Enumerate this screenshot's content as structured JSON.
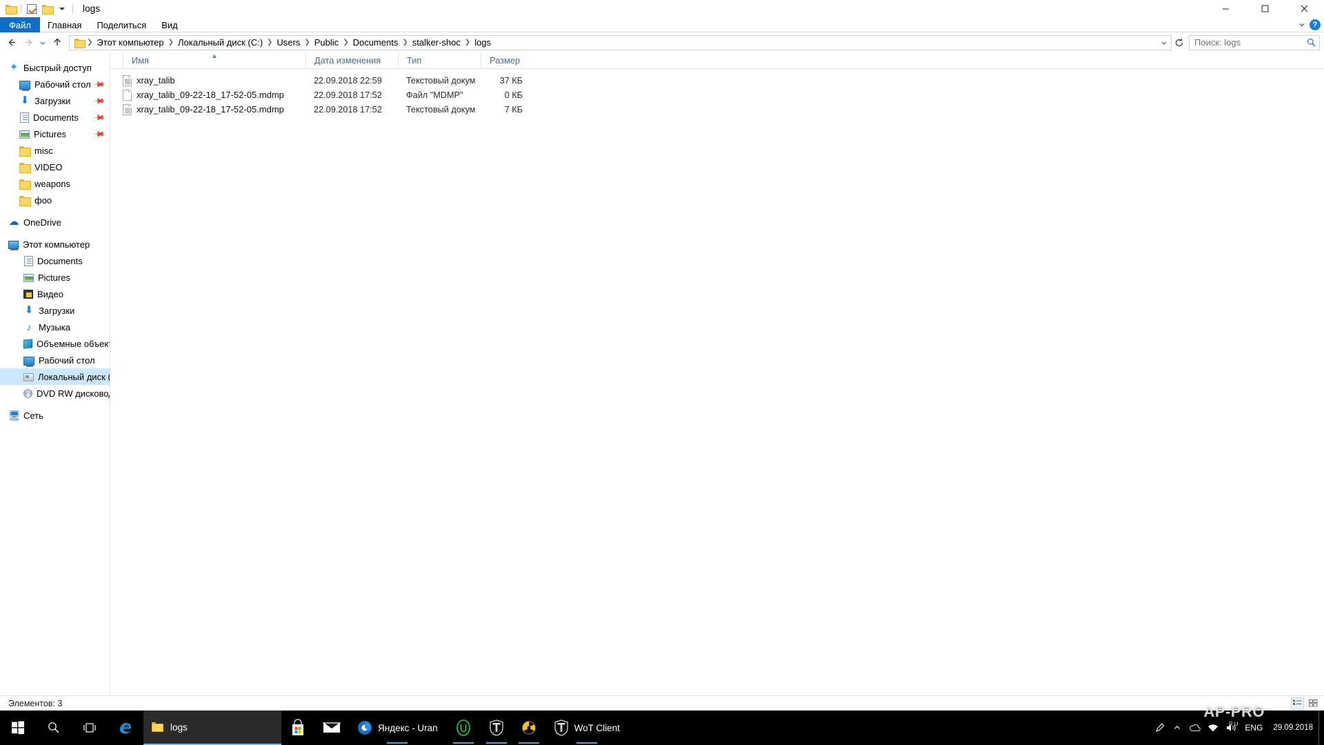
{
  "window": {
    "title": "logs",
    "quick_access_icons": [
      "folder-icon",
      "save-icon",
      "folder-new-icon",
      "customize-caret-icon"
    ],
    "controls": {
      "minimize": "minimize-icon",
      "maximize": "maximize-icon",
      "close": "close-icon"
    }
  },
  "ribbon": {
    "tabs": [
      {
        "label": "Файл",
        "active_blue": true
      },
      {
        "label": "Главная",
        "active_blue": false
      },
      {
        "label": "Поделиться",
        "active_blue": false
      },
      {
        "label": "Вид",
        "active_blue": false
      }
    ],
    "expand_icon": "chevron-down-icon",
    "help_icon": "help-icon"
  },
  "address": {
    "back_icon": "arrow-back-icon",
    "forward_icon": "arrow-forward-icon",
    "recent_icon": "chevron-down-icon",
    "up_icon": "arrow-up-icon",
    "folder_icon": "folder-icon",
    "breadcrumbs": [
      "Этот компьютер",
      "Локальный диск (C:)",
      "Users",
      "Public",
      "Documents",
      "stalker-shoc",
      "logs"
    ],
    "separator": "›",
    "dropdown_icon": "chevron-down-icon",
    "refresh_icon": "refresh-icon",
    "search_placeholder": "Поиск: logs",
    "search_icon": "search-icon"
  },
  "sidebar": {
    "groups": [
      {
        "header": {
          "label": "Быстрый доступ",
          "icon": "star-pin-icon",
          "level": 0
        },
        "items": [
          {
            "label": "Рабочий стол",
            "icon": "desktop-icon",
            "level": 1,
            "pinned": true
          },
          {
            "label": "Загрузки",
            "icon": "download-icon",
            "level": 1,
            "pinned": true
          },
          {
            "label": "Documents",
            "icon": "documents-icon",
            "level": 1,
            "pinned": true
          },
          {
            "label": "Pictures",
            "icon": "pictures-icon",
            "level": 1,
            "pinned": true
          },
          {
            "label": "misc",
            "icon": "folder-icon",
            "level": 1,
            "pinned": false
          },
          {
            "label": "VIDEO",
            "icon": "folder-icon",
            "level": 1,
            "pinned": false
          },
          {
            "label": "weapons",
            "icon": "folder-icon",
            "level": 1,
            "pinned": false
          },
          {
            "label": "фоо",
            "icon": "folder-icon",
            "level": 1,
            "pinned": false
          }
        ]
      },
      {
        "header": {
          "label": "OneDrive",
          "icon": "onedrive-icon",
          "level": 0
        },
        "items": []
      },
      {
        "header": {
          "label": "Этот компьютер",
          "icon": "this-pc-icon",
          "level": 0
        },
        "items": [
          {
            "label": "Documents",
            "icon": "documents-icon",
            "level": 1,
            "pinned": false
          },
          {
            "label": "Pictures",
            "icon": "pictures-icon",
            "level": 1,
            "pinned": false
          },
          {
            "label": "Видео",
            "icon": "video-icon",
            "level": 1,
            "pinned": false
          },
          {
            "label": "Загрузки",
            "icon": "download-icon",
            "level": 1,
            "pinned": false
          },
          {
            "label": "Музыка",
            "icon": "music-icon",
            "level": 1,
            "pinned": false
          },
          {
            "label": "Объемные объекты",
            "icon": "3d-objects-icon",
            "level": 1,
            "pinned": false
          },
          {
            "label": "Рабочий стол",
            "icon": "desktop-icon",
            "level": 1,
            "pinned": false
          },
          {
            "label": "Локальный диск (C:)",
            "icon": "drive-icon",
            "level": 1,
            "pinned": false,
            "selected": true
          },
          {
            "label": "DVD RW дисковод (D:)",
            "icon": "dvd-drive-icon",
            "level": 1,
            "pinned": false
          }
        ]
      },
      {
        "header": {
          "label": "Сеть",
          "icon": "network-icon",
          "level": 0
        },
        "items": []
      }
    ]
  },
  "filelist": {
    "columns": [
      {
        "key": "name",
        "label": "Имя",
        "sorted": true,
        "sort_dir": "asc"
      },
      {
        "key": "date",
        "label": "Дата изменения",
        "sorted": false
      },
      {
        "key": "type",
        "label": "Тип",
        "sorted": false
      },
      {
        "key": "size",
        "label": "Размер",
        "sorted": false
      }
    ],
    "rows": [
      {
        "name": "xray_talib",
        "date": "22.09.2018 22:59",
        "type": "Текстовый докум",
        "size": "37 КБ",
        "icon": "text-file-icon"
      },
      {
        "name": "xray_talib_09-22-18_17-52-05.mdmp",
        "date": "22.09.2018 17:52",
        "type": "Файл \"MDMP\"",
        "size": "0 КБ",
        "icon": "generic-file-icon"
      },
      {
        "name": "xray_talib_09-22-18_17-52-05.mdmp",
        "date": "22.09.2018 17:52",
        "type": "Текстовый докум",
        "size": "7 КБ",
        "icon": "text-file-icon"
      }
    ]
  },
  "statusbar": {
    "item_count": "Элементов: 3",
    "view_details_icon": "details-view-icon",
    "view_tiles_icon": "tiles-view-icon"
  },
  "taskbar": {
    "start_icon": "windows-start-icon",
    "search_icon": "search-icon",
    "taskview_icon": "task-view-icon",
    "pinned": [
      {
        "label": "",
        "icon": "edge-icon"
      }
    ],
    "active_app": {
      "label": "logs",
      "icon": "folder-icon"
    },
    "apps": [
      {
        "label": "",
        "icon": "store-icon"
      },
      {
        "label": "",
        "icon": "mail-icon"
      },
      {
        "label": "Яндекс - Uran",
        "icon": "uran-browser-icon"
      },
      {
        "label": "",
        "icon": "u-circle-icon"
      },
      {
        "label": "",
        "icon": "wot-tank-icon"
      },
      {
        "label": "",
        "icon": "radiation-icon"
      },
      {
        "label": "WoT Client",
        "icon": "wot-tank-icon"
      }
    ],
    "tray": {
      "pen_icon": "pen-tray-icon",
      "chevron_icon": "show-hidden-icons-icon",
      "onedrive_icon": "onedrive-tray-icon",
      "network_icon": "network-tray-icon",
      "volume_icon": "volume-tray-icon",
      "language": "ENG",
      "time": "",
      "date": "29.09.2018"
    },
    "watermark": {
      "main": "AP-PRO",
      "sub": "RU"
    }
  },
  "colors": {
    "accent_blue": "#0f6fc6",
    "selection_blue": "#cce8ff",
    "column_header_text": "#4a6a8a",
    "taskbar_bg": "#000000",
    "folder_yellow": "#fcd667"
  }
}
